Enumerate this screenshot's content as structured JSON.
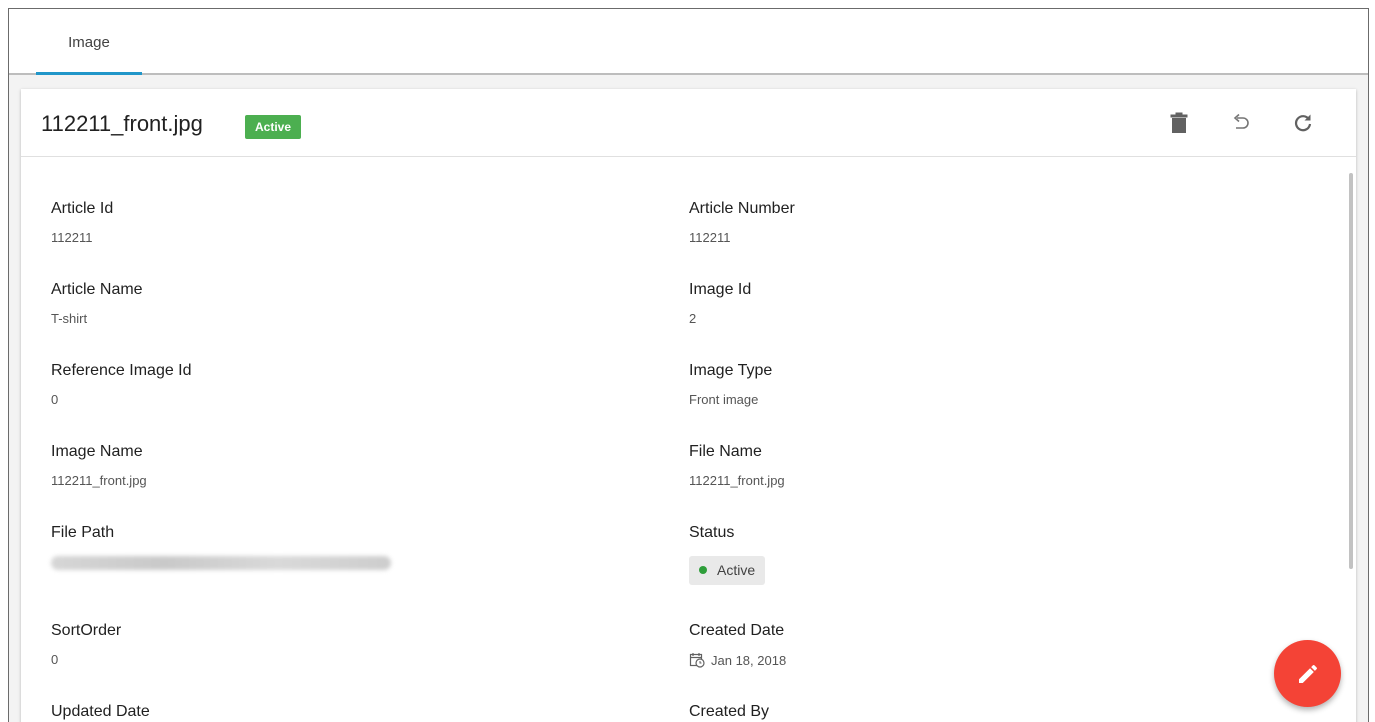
{
  "tabs": [
    {
      "label": "Image",
      "active": true
    }
  ],
  "header": {
    "title": "112211_front.jpg",
    "status_badge": "Active",
    "badge_color": "#4caf50",
    "actions": [
      "delete-icon",
      "undo-icon",
      "refresh-icon"
    ]
  },
  "fields": {
    "article_id": {
      "label": "Article Id",
      "value": "112211"
    },
    "article_number": {
      "label": "Article Number",
      "value": "112211"
    },
    "article_name": {
      "label": "Article Name",
      "value": "T-shirt"
    },
    "image_id": {
      "label": "Image Id",
      "value": "2"
    },
    "reference_image_id": {
      "label": "Reference Image Id",
      "value": "0"
    },
    "image_type": {
      "label": "Image Type",
      "value": "Front image"
    },
    "image_name": {
      "label": "Image Name",
      "value": "112211_front.jpg"
    },
    "file_name": {
      "label": "File Name",
      "value": "112211_front.jpg"
    },
    "file_path": {
      "label": "File Path",
      "value_blurred": true
    },
    "status": {
      "label": "Status",
      "value": "Active",
      "dot_color": "#2e9e3a"
    },
    "sort_order": {
      "label": "SortOrder",
      "value": "0"
    },
    "created_date": {
      "label": "Created Date",
      "value": "Jan 18, 2018"
    },
    "updated_date": {
      "label": "Updated Date"
    },
    "created_by": {
      "label": "Created By"
    }
  },
  "fab": {
    "icon": "edit-icon",
    "color": "#f44336"
  },
  "accent": "#2196c9"
}
